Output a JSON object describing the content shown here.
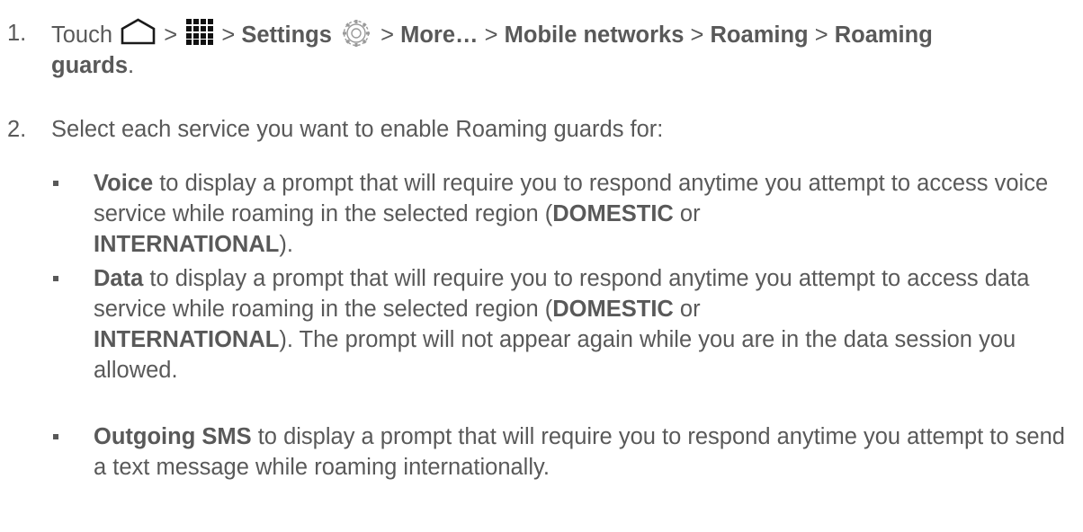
{
  "step1": {
    "number": "1.",
    "touch": "Touch",
    "sep": ">",
    "settings": "Settings",
    "more": "More…",
    "mobile_networks": "Mobile networks",
    "roaming": "Roaming",
    "roaming_guards_a": "Roaming",
    "roaming_guards_b": "guards",
    "period": ".",
    "icons": [
      "home-icon",
      "apps-grid-icon",
      "settings-gear-icon"
    ]
  },
  "step2": {
    "number": "2.",
    "text": "Select each service you want to enable Roaming guards for:"
  },
  "bullets": [
    {
      "term": "Voice",
      "text_a": " to display a prompt that will require you to respond anytime you attempt to access voice service while roaming in the selected region (",
      "region_1": "DOMESTIC",
      "or": " or ",
      "region_2": "INTERNATIONAL",
      "text_b": ")."
    },
    {
      "term": "Data",
      "text_a": " to display a prompt that will require you to respond anytime you attempt to access data service while roaming in the selected region (",
      "region_1": "DOMESTIC",
      "or": " or ",
      "region_2": "INTERNATIONAL",
      "text_b": "). The prompt will not appear again while you are in the data session you allowed."
    },
    {
      "term": "Outgoing SMS",
      "text_a": " to display a prompt that will require you to respond anytime you attempt to send a text message while roaming internationally."
    }
  ]
}
